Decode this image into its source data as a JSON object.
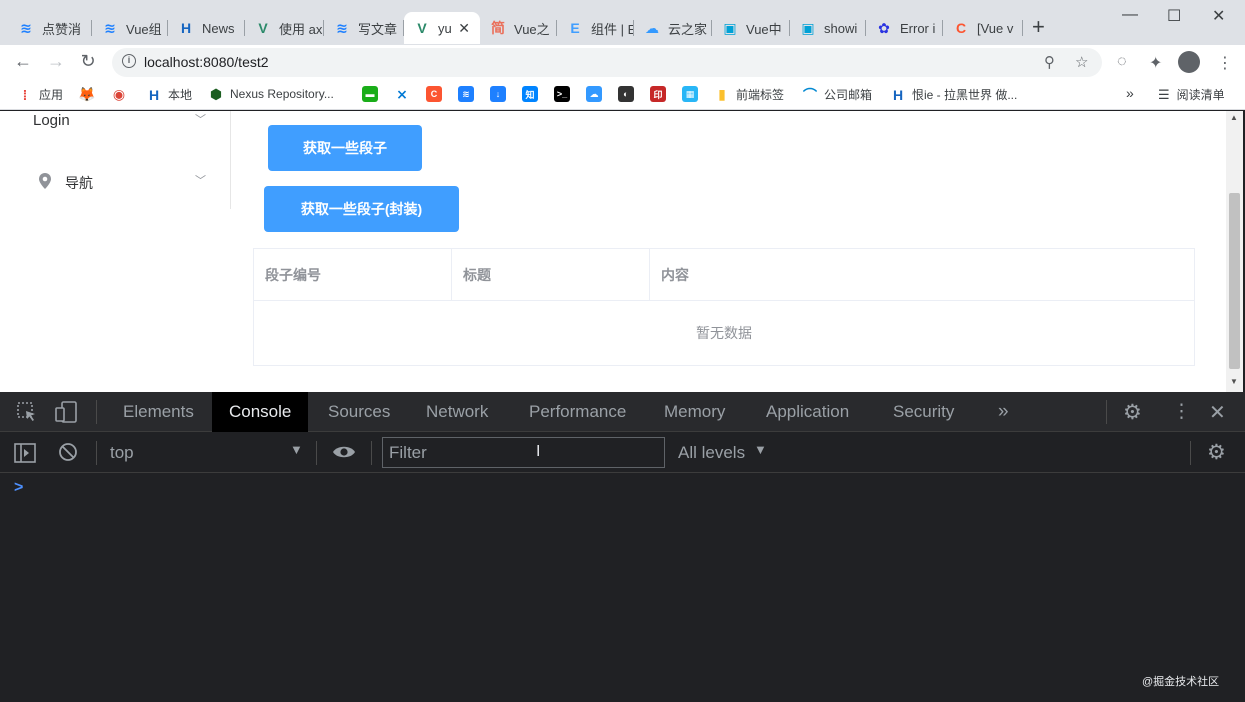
{
  "browser": {
    "tabs": [
      {
        "title": "点赞消",
        "icon": "juejin-icon",
        "color": "#1e80ff"
      },
      {
        "title": "Vue组",
        "icon": "juejin-icon",
        "color": "#1e80ff"
      },
      {
        "title": "News",
        "icon": "hexo-icon",
        "color": "#1565c0"
      },
      {
        "title": "使用 ax",
        "icon": "vue-icon",
        "color": "#2c8a6a"
      },
      {
        "title": "写文章",
        "icon": "juejin-icon",
        "color": "#1e80ff"
      },
      {
        "title": "yu",
        "icon": "vue-icon",
        "color": "#2c8a6a",
        "active": true
      },
      {
        "title": "Vue之",
        "icon": "jianshu-icon",
        "color": "#ea6f5a"
      },
      {
        "title": "组件 | E",
        "icon": "element-icon",
        "color": "#409eff"
      },
      {
        "title": "云之家",
        "icon": "cloud-icon",
        "color": "#3399ff"
      },
      {
        "title": "Vue中",
        "icon": "bilibili-icon",
        "color": "#00a1d6"
      },
      {
        "title": "showi",
        "icon": "bilibili-icon",
        "color": "#00a1d6"
      },
      {
        "title": "Error i",
        "icon": "baidu-icon",
        "color": "#2932e1"
      },
      {
        "title": "[Vue v",
        "icon": "csdn-icon",
        "color": "#fc5531"
      }
    ],
    "url": "localhost:8080/test2",
    "bookmarks": [
      {
        "label": "应用",
        "icon": "apps-icon",
        "color": "#e8453c"
      },
      {
        "label": "",
        "icon": "gitlab-icon",
        "color": "#e24329"
      },
      {
        "label": "",
        "icon": "chrome-icon",
        "color": "#db4437"
      },
      {
        "label": "本地",
        "icon": "hexo-icon",
        "color": "#1565c0"
      },
      {
        "label": "Nexus Repository...",
        "icon": "nexus-icon",
        "color": "#1b5e20"
      },
      {
        "label": "",
        "icon": "bookmark-icon",
        "color": "#1aad19"
      },
      {
        "label": "",
        "icon": "vscode-icon",
        "color": "#0078d4"
      },
      {
        "label": "",
        "icon": "csdn-icon",
        "color": "#fc5531"
      },
      {
        "label": "",
        "icon": "juejin-icon",
        "color": "#1e80ff"
      },
      {
        "label": "",
        "icon": "download-icon",
        "color": "#1e80ff"
      },
      {
        "label": "",
        "icon": "zhihu-icon",
        "color": "#0084ff"
      },
      {
        "label": "",
        "icon": "terminal-icon",
        "color": "#000000"
      },
      {
        "label": "",
        "icon": "cloud-icon",
        "color": "#3399ff"
      },
      {
        "label": "",
        "icon": "docker-icon",
        "color": "#333333"
      },
      {
        "label": "",
        "icon": "seal-icon",
        "color": "#c62828"
      },
      {
        "label": "",
        "icon": "image-icon",
        "color": "#29b6f6"
      },
      {
        "label": "前端标签",
        "icon": "folder-icon",
        "color": "#fbc02d"
      },
      {
        "label": "公司邮箱",
        "icon": "mail-icon",
        "color": "#0288d1"
      },
      {
        "label": "恨ie - 拉黑世界 做...",
        "icon": "hexo-icon",
        "color": "#1565c0"
      }
    ],
    "more_bookmarks": "»",
    "reading_list": "阅读清单"
  },
  "page": {
    "menu": {
      "login": "Login",
      "nav": "导航"
    },
    "buttons": {
      "fetch": "获取一些段子",
      "fetch_wrapped": "获取一些段子(封装)"
    },
    "table": {
      "columns": [
        "段子编号",
        "标题",
        "内容"
      ],
      "empty_text": "暂无数据"
    }
  },
  "devtools": {
    "tabs": [
      "Elements",
      "Console",
      "Sources",
      "Network",
      "Performance",
      "Memory",
      "Application",
      "Security"
    ],
    "active_tab": "Console",
    "context": "top",
    "filter_placeholder": "Filter",
    "levels": "All levels",
    "prompt": ">"
  },
  "watermark": "@掘金技术社区"
}
